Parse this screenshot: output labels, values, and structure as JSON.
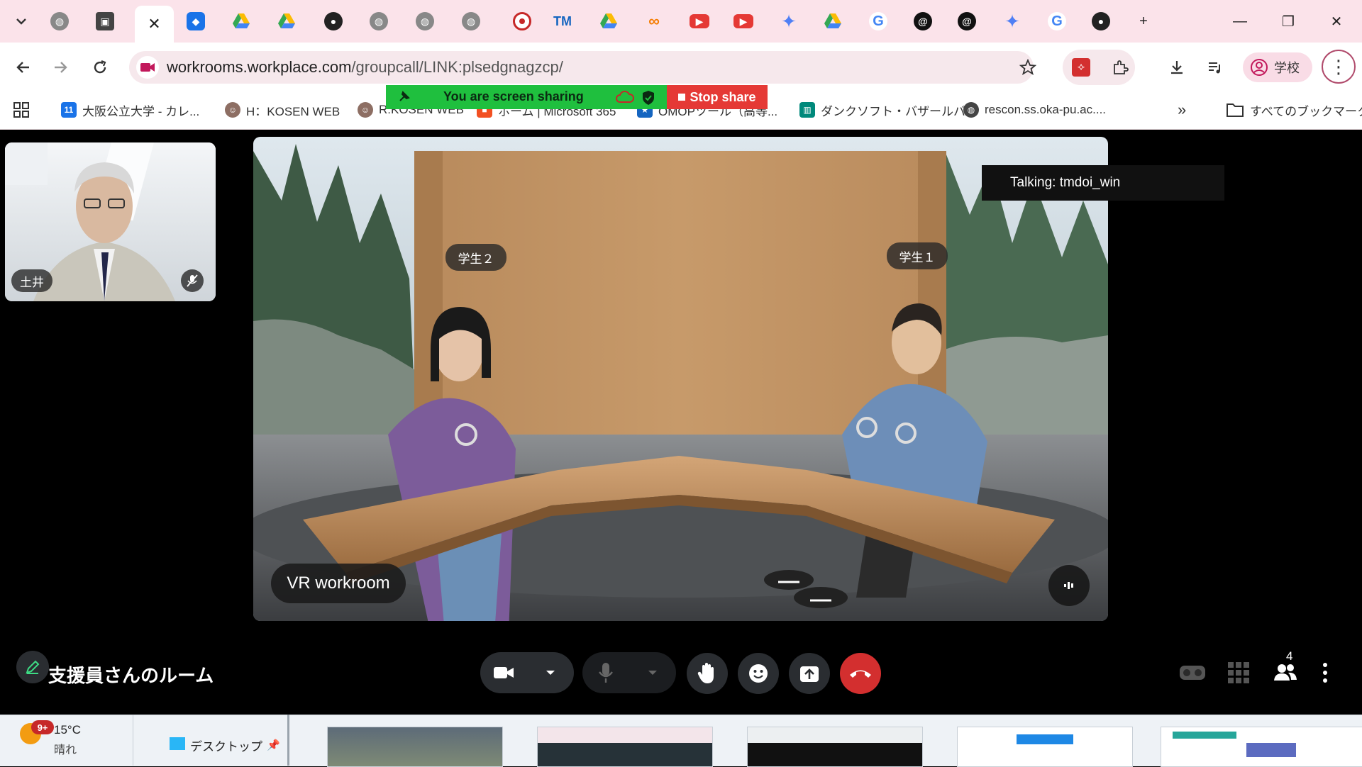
{
  "browser": {
    "active_tab_close": "✕",
    "new_tab": "+",
    "window_controls": {
      "minimize": "—",
      "restore": "❐",
      "close": "✕"
    },
    "tab_icons": [
      "chevron-down-icon",
      "globe-icon",
      "contacts-icon",
      "close-icon",
      "generic-app-icon",
      "google-drive-icon",
      "google-drive-icon",
      "github-icon",
      "globe-icon",
      "globe-icon",
      "globe-icon",
      "record-icon",
      "tm-icon",
      "google-drive-icon",
      "infinity-icon",
      "youtube-icon",
      "youtube-icon",
      "gemini-icon",
      "google-drive-icon",
      "google-icon",
      "threads-icon",
      "threads-icon",
      "gemini-icon",
      "google-icon",
      "github-icon"
    ],
    "tm_text": "TM",
    "address": {
      "host": "workrooms.workplace.com",
      "path": "/groupcall/LINK:plsedgnagzcp/"
    },
    "profile_label": "学校",
    "bookmarks": [
      {
        "label": "大阪公立大学 - カレ...",
        "icon": "calendar-icon",
        "badge": "11"
      },
      {
        "label": "H：KOSEN WEB",
        "icon": "people-icon"
      },
      {
        "label": "R:KOSEN WEB",
        "icon": "people-icon"
      },
      {
        "label": "ホーム | Microsoft 365",
        "icon": "microsoft-icon"
      },
      {
        "label": "OMOPツール（高等...",
        "icon": "bookmark-icon"
      },
      {
        "label": "ダンクソフト・バザールバ...",
        "icon": "dankosoft-icon"
      },
      {
        "label": "rescon.ss.oka-pu.ac....",
        "icon": "globe-icon"
      }
    ],
    "bookmarks_overflow": "»",
    "all_bookmarks": "すべてのブックマーク"
  },
  "share_banner": {
    "text": "You are screen sharing",
    "stop_label": "Stop share"
  },
  "call": {
    "self_name": "土井",
    "vr_label": "VR workroom",
    "talking": "Talking: tmdoi_win",
    "avatars": [
      {
        "label": "学生２"
      },
      {
        "label": "学生１"
      }
    ],
    "room_name": "支援員さんのルーム",
    "participant_count": "4"
  },
  "taskbar": {
    "weather_badge": "9+",
    "temperature": "15°C",
    "condition": "晴れ",
    "desktop_label": "デスクトップ"
  },
  "colors": {
    "tab_strip": "#fbe3ea",
    "share_green": "#1fbf3e",
    "stop_red": "#e53935",
    "end_call_red": "#d32f2f"
  }
}
